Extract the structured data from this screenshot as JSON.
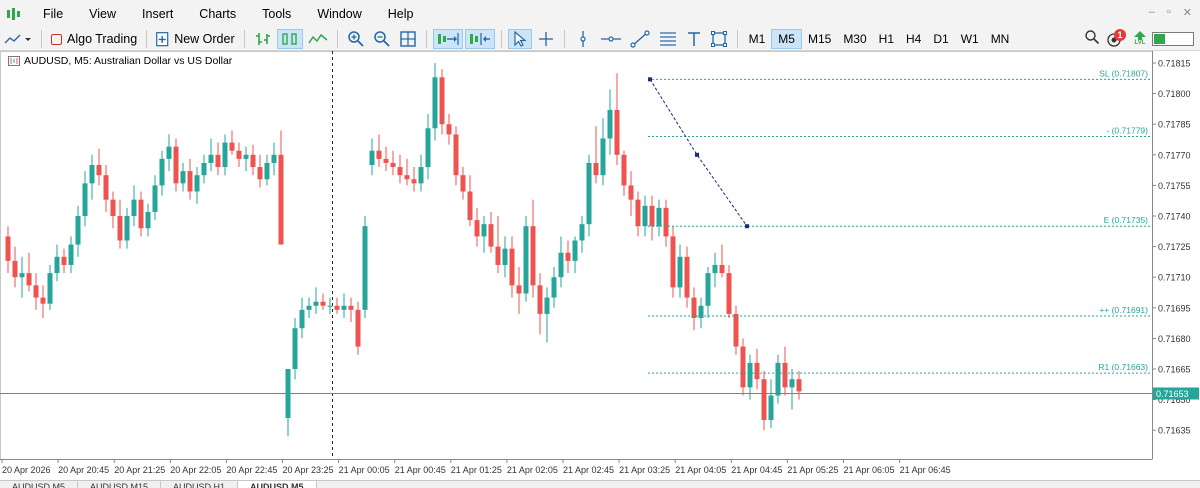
{
  "menu": [
    "File",
    "View",
    "Insert",
    "Charts",
    "Tools",
    "Window",
    "Help"
  ],
  "toolbar": {
    "algo_trading": "Algo Trading",
    "new_order": "New Order",
    "timeframes": [
      "M1",
      "M5",
      "M15",
      "M30",
      "H1",
      "H4",
      "D1",
      "W1",
      "MN"
    ],
    "active_timeframe": "M5",
    "notification_count": "1",
    "level_label": "LVL",
    "level_fraction": 0.3
  },
  "chart": {
    "title": "AUDUSD, M5:  Australian Dollar vs US Dollar",
    "current_price": "0.71653",
    "price_ticks": [
      "0.71815",
      "0.71800",
      "0.71785",
      "0.71770",
      "0.71755",
      "0.71740",
      "0.71725",
      "0.71710",
      "0.71695",
      "0.71680",
      "0.71665",
      "0.71650",
      "0.71635"
    ],
    "time_labels": [
      "20 Apr 2026",
      "20 Apr 20:45",
      "20 Apr 21:25",
      "20 Apr 22:05",
      "20 Apr 22:45",
      "20 Apr 23:25",
      "21 Apr 00:05",
      "21 Apr 00:45",
      "21 Apr 01:25",
      "21 Apr 02:05",
      "21 Apr 02:45",
      "21 Apr 03:25",
      "21 Apr 04:05",
      "21 Apr 04:45",
      "21 Apr 05:25",
      "21 Apr 06:05",
      "21 Apr 06:45"
    ],
    "levels": [
      {
        "label": "SL (0.71807)",
        "price": 0.71807
      },
      {
        "label": "- (0.71779)",
        "price": 0.71779
      },
      {
        "label": "E (0.71735)",
        "price": 0.71735
      },
      {
        "label": "++ (0.71691)",
        "price": 0.71691
      },
      {
        "label": "R1 (0.71663)",
        "price": 0.71663
      }
    ],
    "colors": {
      "up": "#26a69a",
      "down": "#ef5350",
      "level": "#26a69a",
      "trend": "#1a2a80",
      "price_line": "#26a69a"
    }
  },
  "tabs": [
    "AUDUSD,M5",
    "AUDUSD,M15",
    "AUDUSD,H1",
    "AUDUSD,M5"
  ],
  "active_tab": 3
}
